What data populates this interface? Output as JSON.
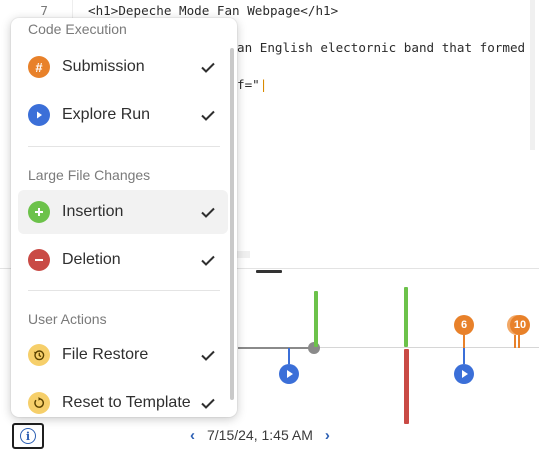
{
  "editor": {
    "line_number": "7",
    "line1": "<h1>Depeche Mode Fan Webpage</h1>",
    "line2": "an English electornic band that formed",
    "line3_prefix": "f=\"",
    "line3_cursor": "|"
  },
  "menu": {
    "sections": [
      {
        "title": "Code Execution",
        "items": [
          {
            "label": "Submission",
            "icon": "hash-icon",
            "icon_color": "#e8812a",
            "checked": true
          },
          {
            "label": "Explore Run",
            "icon": "play-icon",
            "icon_color": "#3b6fd8",
            "checked": true
          }
        ]
      },
      {
        "title": "Large File Changes",
        "items": [
          {
            "label": "Insertion",
            "icon": "plus-icon",
            "icon_color": "#6cc24a",
            "checked": true
          },
          {
            "label": "Deletion",
            "icon": "minus-icon",
            "icon_color": "#c94a45",
            "checked": true
          }
        ]
      },
      {
        "title": "User Actions",
        "items": [
          {
            "label": "File Restore",
            "icon": "history-icon",
            "icon_color": "#f6cf6a",
            "checked": true
          },
          {
            "label": "Reset to Template",
            "icon": "reset-icon",
            "icon_color": "#f6cf6a",
            "checked": true
          }
        ]
      }
    ]
  },
  "timeline": {
    "date": "7/15/24, 1:45 AM",
    "badges": [
      "6",
      "10"
    ],
    "colors": {
      "submission": "#e8812a",
      "run": "#3b6fd8",
      "insertion": "#6cc24a",
      "deletion": "#c94a45"
    }
  }
}
